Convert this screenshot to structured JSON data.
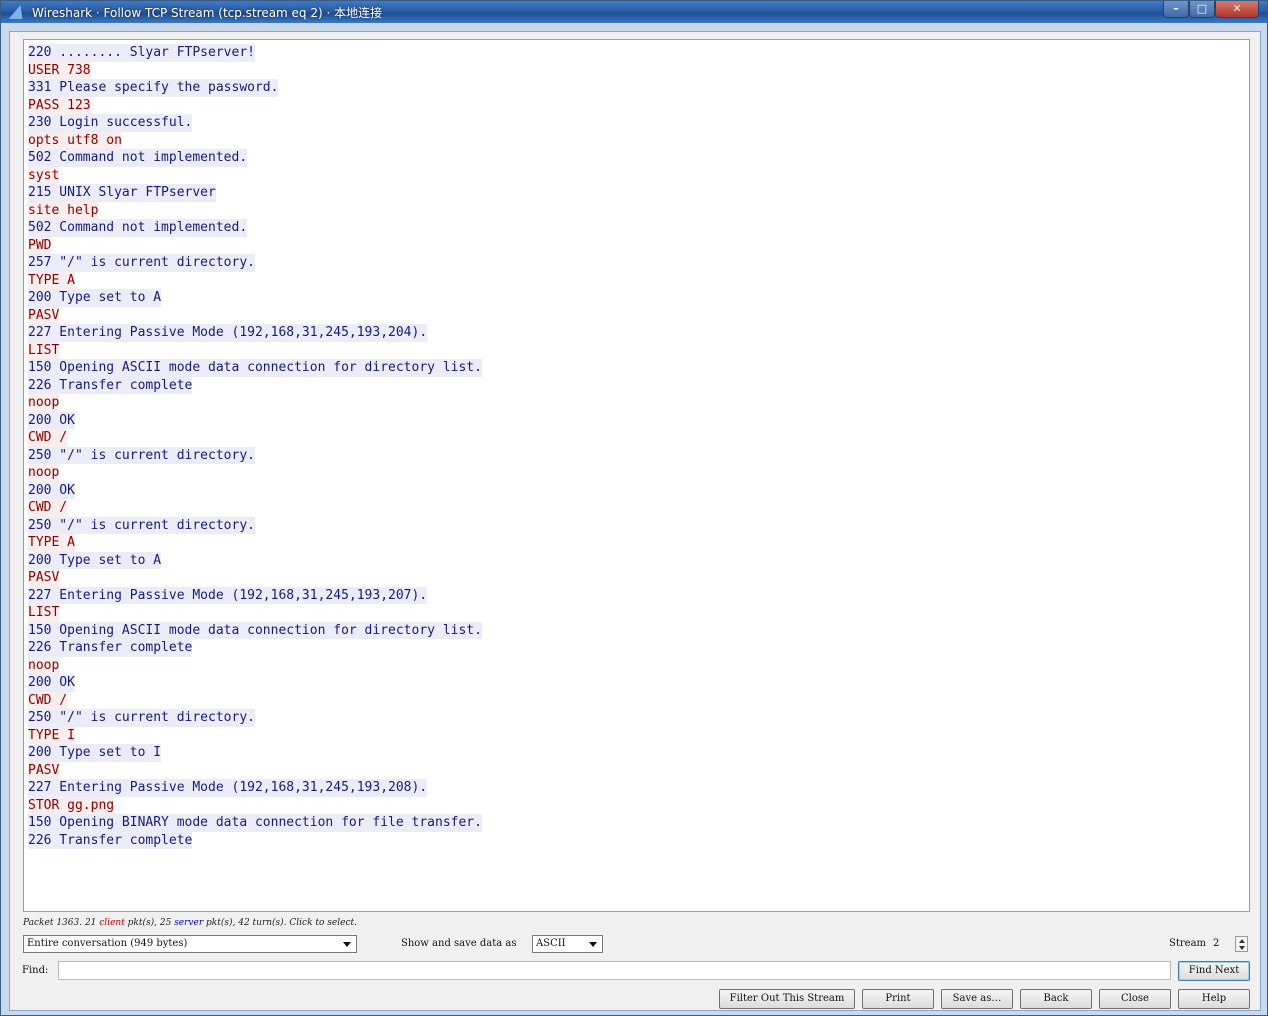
{
  "window": {
    "title": "Wireshark · Follow TCP Stream (tcp.stream eq 2) · 本地连接"
  },
  "stream_lines": [
    {
      "text": "220 ........ Slyar FTPserver!",
      "dir": "server"
    },
    {
      "text": "USER 738",
      "dir": "client"
    },
    {
      "text": "331 Please specify the password.",
      "dir": "server"
    },
    {
      "text": "PASS 123",
      "dir": "client"
    },
    {
      "text": "230 Login successful.",
      "dir": "server"
    },
    {
      "text": "opts utf8 on",
      "dir": "client"
    },
    {
      "text": "502 Command not implemented.",
      "dir": "server"
    },
    {
      "text": "syst",
      "dir": "client"
    },
    {
      "text": "215 UNIX Slyar FTPserver",
      "dir": "server"
    },
    {
      "text": "site help",
      "dir": "client"
    },
    {
      "text": "502 Command not implemented.",
      "dir": "server"
    },
    {
      "text": "PWD",
      "dir": "client"
    },
    {
      "text": "257 \"/\" is current directory.",
      "dir": "server"
    },
    {
      "text": "TYPE A",
      "dir": "client"
    },
    {
      "text": "200 Type set to A",
      "dir": "server"
    },
    {
      "text": "PASV",
      "dir": "client"
    },
    {
      "text": "227 Entering Passive Mode (192,168,31,245,193,204).",
      "dir": "server"
    },
    {
      "text": "LIST",
      "dir": "client"
    },
    {
      "text": "150 Opening ASCII mode data connection for directory list.",
      "dir": "server"
    },
    {
      "text": "226 Transfer complete",
      "dir": "server"
    },
    {
      "text": "noop",
      "dir": "client"
    },
    {
      "text": "200 OK",
      "dir": "server"
    },
    {
      "text": "CWD /",
      "dir": "client"
    },
    {
      "text": "250 \"/\" is current directory.",
      "dir": "server"
    },
    {
      "text": "noop",
      "dir": "client"
    },
    {
      "text": "200 OK",
      "dir": "server"
    },
    {
      "text": "CWD /",
      "dir": "client"
    },
    {
      "text": "250 \"/\" is current directory.",
      "dir": "server"
    },
    {
      "text": "TYPE A",
      "dir": "client"
    },
    {
      "text": "200 Type set to A",
      "dir": "server"
    },
    {
      "text": "PASV",
      "dir": "client"
    },
    {
      "text": "227 Entering Passive Mode (192,168,31,245,193,207).",
      "dir": "server"
    },
    {
      "text": "LIST",
      "dir": "client"
    },
    {
      "text": "150 Opening ASCII mode data connection for directory list.",
      "dir": "server"
    },
    {
      "text": "226 Transfer complete",
      "dir": "server"
    },
    {
      "text": "noop",
      "dir": "client"
    },
    {
      "text": "200 OK",
      "dir": "server"
    },
    {
      "text": "CWD /",
      "dir": "client"
    },
    {
      "text": "250 \"/\" is current directory.",
      "dir": "server"
    },
    {
      "text": "TYPE I",
      "dir": "client"
    },
    {
      "text": "200 Type set to I",
      "dir": "server"
    },
    {
      "text": "PASV",
      "dir": "client"
    },
    {
      "text": "227 Entering Passive Mode (192,168,31,245,193,208).",
      "dir": "server"
    },
    {
      "text": "STOR gg.png",
      "dir": "client"
    },
    {
      "text": "150 Opening BINARY mode data connection for file transfer.",
      "dir": "server"
    },
    {
      "text": "226 Transfer complete",
      "dir": "server"
    }
  ],
  "status": {
    "prefix": "Packet 1363. 21 ",
    "client_word": "client",
    "middle": " pkt(s), 25 ",
    "server_word": "server",
    "suffix": " pkt(s), 42 turn(s). Click to select."
  },
  "conversation_select": {
    "value": "Entire conversation (949 bytes)"
  },
  "show_save_label": "Show and save data as",
  "format_select": {
    "value": "ASCII"
  },
  "stream": {
    "label": "Stream",
    "value": "2"
  },
  "find": {
    "label": "Find:",
    "value": "",
    "find_next_label": "Find Next"
  },
  "buttons": {
    "filter_out": "Filter Out This Stream",
    "print": "Print",
    "save_as": "Save as…",
    "back": "Back",
    "close": "Close",
    "help": "Help"
  },
  "colors": {
    "client_text": "#8b0000",
    "client_bg": "#faeded",
    "server_text": "#1a1a7a",
    "server_bg": "#ececf8"
  },
  "icons": {
    "app": "wireshark-fin-icon",
    "minimize": "minimize-icon",
    "maximize": "maximize-icon",
    "close": "close-icon"
  }
}
